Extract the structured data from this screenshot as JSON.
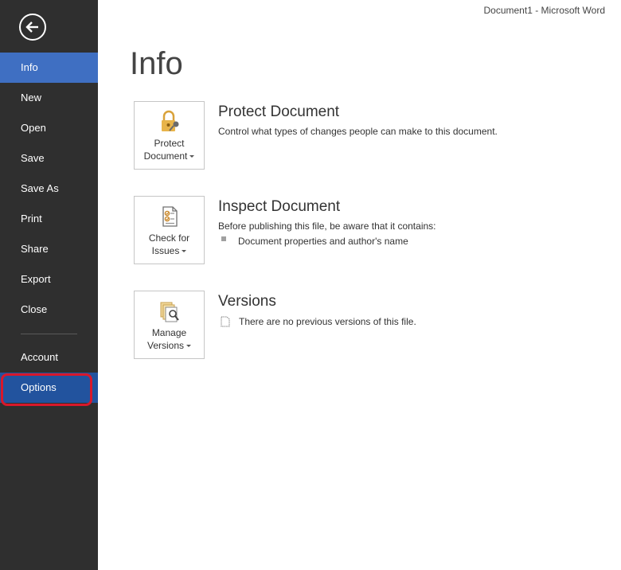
{
  "window": {
    "title": "Document1 - Microsoft Word"
  },
  "sidebar": {
    "back_icon": "back-arrow-icon",
    "items": [
      {
        "label": "Info",
        "active": true
      },
      {
        "label": "New"
      },
      {
        "label": "Open"
      },
      {
        "label": "Save"
      },
      {
        "label": "Save As"
      },
      {
        "label": "Print"
      },
      {
        "label": "Share"
      },
      {
        "label": "Export"
      },
      {
        "label": "Close"
      }
    ],
    "bottom_items": [
      {
        "label": "Account"
      },
      {
        "label": "Options",
        "highlighted": true
      }
    ]
  },
  "main": {
    "title": "Info",
    "sections": [
      {
        "tile_line1": "Protect",
        "tile_line2": "Document",
        "tile_icon": "lock-key-icon",
        "heading": "Protect Document",
        "description": "Control what types of changes people can make to this document."
      },
      {
        "tile_line1": "Check for",
        "tile_line2": "Issues",
        "tile_icon": "checklist-icon",
        "heading": "Inspect Document",
        "description": "Before publishing this file, be aware that it contains:",
        "bullets": [
          "Document properties and author's name"
        ]
      },
      {
        "tile_line1": "Manage",
        "tile_line2": "Versions",
        "tile_icon": "versions-search-icon",
        "heading": "Versions",
        "description": "There are no previous versions of this file."
      }
    ]
  },
  "colors": {
    "sidebar_bg": "#2f2f2f",
    "active_item": "#3f6fc2",
    "options_item": "#22539e",
    "highlight_border": "#d8182b"
  }
}
